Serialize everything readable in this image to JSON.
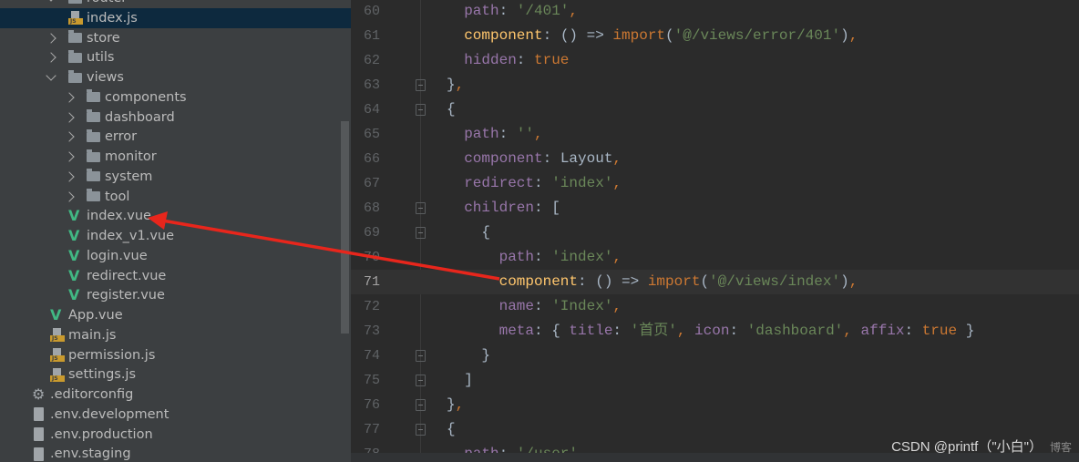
{
  "tree": [
    {
      "label": "router",
      "type": "folder",
      "open": true,
      "level": 1
    },
    {
      "label": "index.js",
      "type": "js",
      "level": 2,
      "selected": true
    },
    {
      "label": "store",
      "type": "folder",
      "open": false,
      "level": 1
    },
    {
      "label": "utils",
      "type": "folder",
      "open": false,
      "level": 1
    },
    {
      "label": "views",
      "type": "folder",
      "open": true,
      "level": 1
    },
    {
      "label": "components",
      "type": "folder",
      "open": false,
      "level": 2
    },
    {
      "label": "dashboard",
      "type": "folder",
      "open": false,
      "level": 2
    },
    {
      "label": "error",
      "type": "folder",
      "open": false,
      "level": 2
    },
    {
      "label": "monitor",
      "type": "folder",
      "open": false,
      "level": 2
    },
    {
      "label": "system",
      "type": "folder",
      "open": false,
      "level": 2
    },
    {
      "label": "tool",
      "type": "folder",
      "open": false,
      "level": 2
    },
    {
      "label": "index.vue",
      "type": "vue",
      "level": 2
    },
    {
      "label": "index_v1.vue",
      "type": "vue",
      "level": 2
    },
    {
      "label": "login.vue",
      "type": "vue",
      "level": 2
    },
    {
      "label": "redirect.vue",
      "type": "vue",
      "level": 2
    },
    {
      "label": "register.vue",
      "type": "vue",
      "level": 2
    },
    {
      "label": "App.vue",
      "type": "vue",
      "level": 1
    },
    {
      "label": "main.js",
      "type": "js",
      "level": 1
    },
    {
      "label": "permission.js",
      "type": "js",
      "level": 1
    },
    {
      "label": "settings.js",
      "type": "js",
      "level": 1
    },
    {
      "label": ".editorconfig",
      "type": "gear",
      "level": 0
    },
    {
      "label": ".env.development",
      "type": "doc",
      "level": 0
    },
    {
      "label": ".env.production",
      "type": "doc",
      "level": 0
    },
    {
      "label": ".env.staging",
      "type": "doc",
      "level": 0
    }
  ],
  "code": [
    {
      "n": "60",
      "indent": 2,
      "tokens": [
        [
          "key",
          "path"
        ],
        [
          "p",
          ": "
        ],
        [
          "str",
          "'/401'"
        ],
        [
          "kw",
          ","
        ]
      ]
    },
    {
      "n": "61",
      "indent": 2,
      "tokens": [
        [
          "fn",
          "component"
        ],
        [
          "p",
          ": () => "
        ],
        [
          "kw",
          "import"
        ],
        [
          "p",
          "("
        ],
        [
          "str",
          "'@/views/error/401'"
        ],
        [
          "p",
          ")"
        ],
        [
          "kw",
          ","
        ]
      ]
    },
    {
      "n": "62",
      "indent": 2,
      "tokens": [
        [
          "key",
          "hidden"
        ],
        [
          "p",
          ": "
        ],
        [
          "kw",
          "true"
        ]
      ]
    },
    {
      "n": "63",
      "indent": 0,
      "fold": true,
      "tokens": [
        [
          "p",
          "}"
        ],
        [
          "kw",
          ","
        ]
      ]
    },
    {
      "n": "64",
      "indent": 0,
      "fold": true,
      "tokens": [
        [
          "p",
          "{"
        ]
      ]
    },
    {
      "n": "65",
      "indent": 2,
      "tokens": [
        [
          "key",
          "path"
        ],
        [
          "p",
          ": "
        ],
        [
          "str",
          "''"
        ],
        [
          "kw",
          ","
        ]
      ]
    },
    {
      "n": "66",
      "indent": 2,
      "tokens": [
        [
          "key",
          "component"
        ],
        [
          "p",
          ": Layout"
        ],
        [
          "kw",
          ","
        ]
      ]
    },
    {
      "n": "67",
      "indent": 2,
      "tokens": [
        [
          "key",
          "redirect"
        ],
        [
          "p",
          ": "
        ],
        [
          "str",
          "'index'"
        ],
        [
          "kw",
          ","
        ]
      ]
    },
    {
      "n": "68",
      "indent": 2,
      "fold": true,
      "tokens": [
        [
          "key",
          "children"
        ],
        [
          "p",
          ": ["
        ]
      ]
    },
    {
      "n": "69",
      "indent": 4,
      "fold": true,
      "tokens": [
        [
          "p",
          "{"
        ]
      ]
    },
    {
      "n": "70",
      "indent": 6,
      "tokens": [
        [
          "key",
          "path"
        ],
        [
          "p",
          ": "
        ],
        [
          "str",
          "'index'"
        ],
        [
          "kw",
          ","
        ]
      ]
    },
    {
      "n": "71",
      "indent": 6,
      "current": true,
      "tokens": [
        [
          "fn",
          "component"
        ],
        [
          "p",
          ": () => "
        ],
        [
          "kw",
          "import"
        ],
        [
          "p",
          "("
        ],
        [
          "str",
          "'@/views/index'"
        ],
        [
          "p",
          ")"
        ],
        [
          "kw",
          ","
        ]
      ]
    },
    {
      "n": "72",
      "indent": 6,
      "tokens": [
        [
          "key",
          "name"
        ],
        [
          "p",
          ": "
        ],
        [
          "str",
          "'Index'"
        ],
        [
          "kw",
          ","
        ]
      ]
    },
    {
      "n": "73",
      "indent": 6,
      "tokens": [
        [
          "key",
          "meta"
        ],
        [
          "p",
          ": { "
        ],
        [
          "key",
          "title"
        ],
        [
          "p",
          ": "
        ],
        [
          "str",
          "'首页'"
        ],
        [
          "kw",
          ", "
        ],
        [
          "key",
          "icon"
        ],
        [
          "p",
          ": "
        ],
        [
          "str",
          "'dashboard'"
        ],
        [
          "kw",
          ", "
        ],
        [
          "key",
          "affix"
        ],
        [
          "p",
          ": "
        ],
        [
          "kw",
          "true"
        ],
        [
          "p",
          " }"
        ]
      ]
    },
    {
      "n": "74",
      "indent": 4,
      "fold": true,
      "tokens": [
        [
          "p",
          "}"
        ]
      ]
    },
    {
      "n": "75",
      "indent": 2,
      "fold": true,
      "tokens": [
        [
          "p",
          "]"
        ]
      ]
    },
    {
      "n": "76",
      "indent": 0,
      "fold": true,
      "tokens": [
        [
          "p",
          "}"
        ],
        [
          "kw",
          ","
        ]
      ]
    },
    {
      "n": "77",
      "indent": 0,
      "fold": true,
      "tokens": [
        [
          "p",
          "{"
        ]
      ]
    },
    {
      "n": "78",
      "indent": 2,
      "tokens": [
        [
          "key",
          "path"
        ],
        [
          "p",
          ": "
        ],
        [
          "str",
          "'/user'"
        ]
      ]
    }
  ],
  "watermark": "CSDN @printf（\"小白\"）",
  "watermark2": "博客",
  "colors": {
    "arrow": "#e8261c",
    "selected": "#0d293e"
  }
}
